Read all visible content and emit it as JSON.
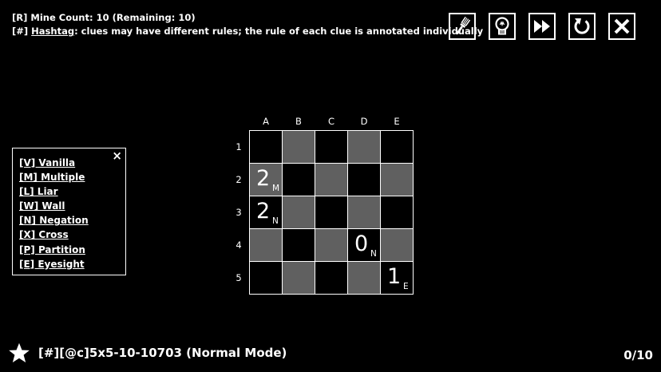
{
  "header": {
    "mine_tag": "[R]",
    "mine_text": " Mine Count:  10 (Remaining: 10)",
    "rule_tag": "[#]",
    "rule_name": "Hashtag",
    "rule_desc": ": clues may have different rules; the rule of each clue is annotated individually"
  },
  "toolbar": {
    "buttons": [
      {
        "name": "brush-icon",
        "label": ""
      },
      {
        "name": "hint-bulb-icon",
        "label": ""
      },
      {
        "name": "fast-forward-icon",
        "label": ""
      },
      {
        "name": "restart-icon",
        "label": ""
      },
      {
        "name": "close-icon",
        "label": ""
      }
    ]
  },
  "legend": {
    "close_label": "×",
    "items": [
      "[V] Vanilla",
      "[M] Multiple",
      "[L] Liar",
      "[W] Wall",
      "[N] Negation",
      "[X] Cross",
      "[P] Partition",
      "[E] Eyesight"
    ]
  },
  "board": {
    "columns": [
      "A",
      "B",
      "C",
      "D",
      "E"
    ],
    "rows": [
      "1",
      "2",
      "3",
      "4",
      "5"
    ],
    "clues": [
      {
        "cell": "A2",
        "value": "2",
        "rule": "M"
      },
      {
        "cell": "A3",
        "value": "2",
        "rule": "N"
      },
      {
        "cell": "D4",
        "value": "0",
        "rule": "N"
      },
      {
        "cell": "E5",
        "value": "1",
        "rule": "E"
      }
    ],
    "colors": {
      "dark": "#000000",
      "shaded": "#606060",
      "grid": "#ffffff"
    }
  },
  "footer": {
    "title": "[#][@c]5x5-10-10703 (Normal Mode)",
    "progress": "0/10"
  }
}
